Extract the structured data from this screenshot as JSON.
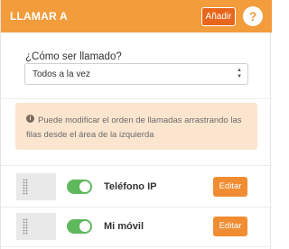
{
  "header": {
    "title": "LLAMAR A",
    "add_label": "Añadir",
    "help_label": "?"
  },
  "call_mode": {
    "label": "¿Cómo ser llamado?",
    "selected": "Todos a la vez"
  },
  "info": {
    "icon": "info-icon",
    "text": "Puede modificar el orden de llamadas arrastrando las filas desde el área de la izquierda"
  },
  "rows": [
    {
      "label": "Teléfono IP",
      "enabled": true,
      "edit_label": "Editar"
    },
    {
      "label": "Mi móvil",
      "enabled": true,
      "edit_label": "Editar"
    }
  ],
  "colors": {
    "header_bg": "#f39c3c",
    "add_button_bg": "#e8661b",
    "edit_button_bg": "#f08d32",
    "toggle_on": "#5fb85c",
    "info_bg": "#fbe5cf"
  }
}
